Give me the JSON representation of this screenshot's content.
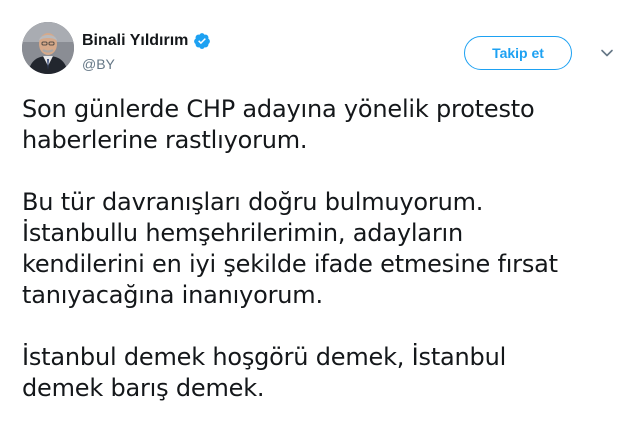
{
  "author": {
    "display_name": "Binali Yıldırım",
    "handle": "@BY",
    "verified": true
  },
  "actions": {
    "follow_label": "Takip et"
  },
  "icons": {
    "verified": "verified-badge-icon",
    "caret": "chevron-down-icon",
    "avatar": "profile-photo"
  },
  "colors": {
    "accent": "#1da1f2",
    "text": "#14171a",
    "secondary": "#657786"
  },
  "tweet": {
    "paragraphs": [
      [
        "Son günlerde CHP adayına yönelik protesto",
        "haberlerine rastlıyorum."
      ],
      [
        "Bu tür davranışları doğru bulmuyorum.",
        "İstanbullu hemşehrilerimin, adayların",
        "kendilerini en iyi şekilde ifade etmesine fırsat",
        "tanıyacağına inanıyorum."
      ],
      [
        "İstanbul demek hoşgörü demek, İstanbul",
        "demek barış demek."
      ]
    ]
  }
}
